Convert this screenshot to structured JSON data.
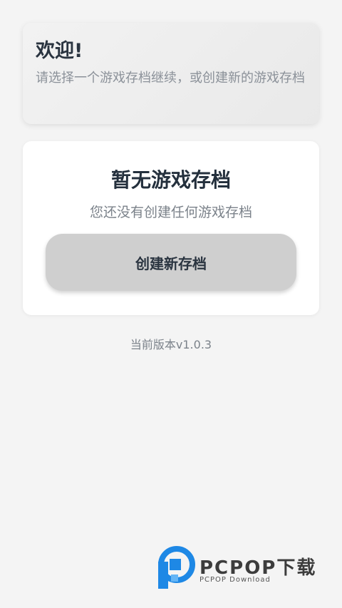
{
  "welcome": {
    "title": "欢迎!",
    "subtitle": "请选择一个游戏存档继续，或创建新的游戏存档"
  },
  "empty_state": {
    "title": "暂无游戏存档",
    "subtitle": "您还没有创建任何游戏存档",
    "create_label": "创建新存档"
  },
  "footer": {
    "version": "当前版本v1.0.3"
  },
  "watermark": {
    "brand": "PCPOP下载",
    "tagline": "PCPOP Download"
  },
  "colors": {
    "background": "#f4f4f4",
    "title_text": "#2a3440",
    "muted_text": "#7b828a",
    "button_bg": "#cfcfcf",
    "logo_blue": "#1e88e5"
  }
}
